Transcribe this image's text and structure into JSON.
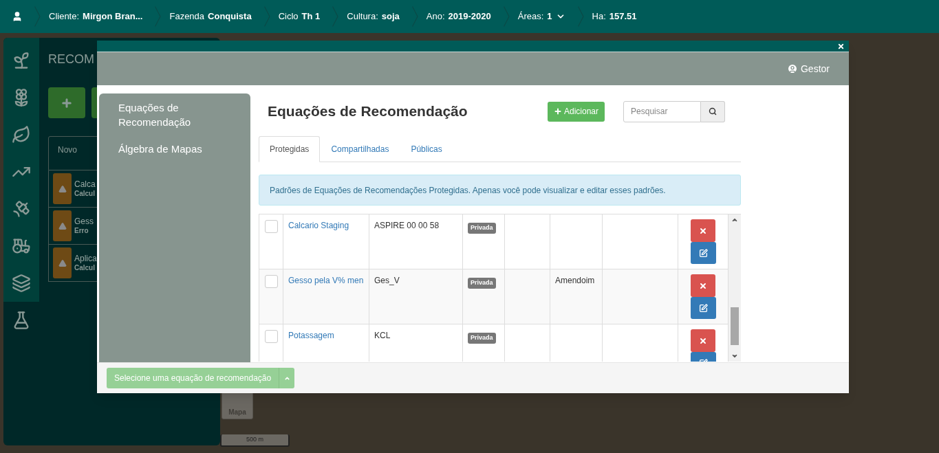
{
  "top_bar": {
    "items": [
      {
        "label": "Cliente:",
        "value": "Mirgon Bran...",
        "dropdown": false
      },
      {
        "label": "Fazenda",
        "value": "Conquista",
        "dropdown": false
      },
      {
        "label": "Ciclo",
        "value": "Th 1",
        "dropdown": false
      },
      {
        "label": "Cultura:",
        "value": "soja",
        "dropdown": false
      },
      {
        "label": "Ano:",
        "value": "2019-2020",
        "dropdown": false
      },
      {
        "label": "Áreas:",
        "value": "1",
        "dropdown": true
      },
      {
        "label": "Ha:",
        "value": "157.51",
        "dropdown": false
      }
    ]
  },
  "sidebar": {
    "items": [
      {
        "selected": false
      },
      {
        "selected": false
      },
      {
        "selected": false
      },
      {
        "selected": false
      },
      {
        "selected": false
      },
      {
        "selected": false
      },
      {
        "selected": false
      },
      {
        "selected": true
      }
    ]
  },
  "background_panel": {
    "title": "RECOM",
    "header": "Novo",
    "items": [
      {
        "title": "Calca",
        "status": "Calcul"
      },
      {
        "title": "Gess",
        "status": "Erro"
      },
      {
        "title": "Aplica",
        "status": "Calcul"
      }
    ]
  },
  "map": {
    "layer_button": "Mapa",
    "scale": "500 m"
  },
  "modal": {
    "user": "Gestor",
    "nav": [
      "Equações de Recomendação",
      "Álgebra de Mapas"
    ],
    "title": "Equações de Recomendação",
    "add_button": "Adicionar",
    "search": {
      "placeholder": "Pesquisar"
    },
    "tabs": [
      {
        "label": "Protegidas",
        "selected": true
      },
      {
        "label": "Compartilhadas",
        "selected": false
      },
      {
        "label": "Públicas",
        "selected": false
      }
    ],
    "alert": "Padrões de Equações de Recomendações Protegidas. Apenas você pode visualizar e editar esses padrões.",
    "rows": [
      {
        "checked": false,
        "name": "Calcario Staging",
        "code": "ASPIRE 00 00 58",
        "badge": "Privada"
      },
      {
        "checked": false,
        "name": "Gesso pela V% men",
        "code": "Ges_V",
        "badge": "Privada",
        "column_6": "Amendoim"
      },
      {
        "checked": false,
        "name": "Potassagem",
        "code": "KCL",
        "badge": "Privada"
      }
    ],
    "footer_button": "Selecione uma equação de recomendação"
  }
}
